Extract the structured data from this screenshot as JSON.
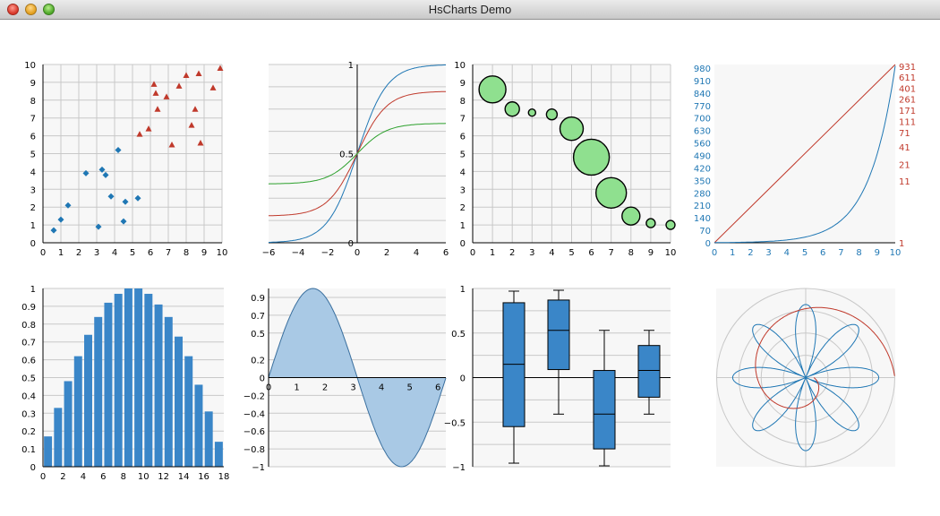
{
  "window": {
    "title": "HsCharts Demo"
  },
  "chart_data": [
    {
      "type": "scatter",
      "xlim": [
        0,
        10
      ],
      "ylim": [
        0,
        10
      ],
      "xticks": [
        "0",
        "1",
        "2",
        "3",
        "4",
        "5",
        "6",
        "7",
        "8",
        "9",
        "10"
      ],
      "yticks": [
        "0",
        "1",
        "2",
        "3",
        "4",
        "5",
        "6",
        "7",
        "8",
        "9",
        "10"
      ],
      "grid": true,
      "series": [
        {
          "marker": "diamond",
          "color": "#1f77b4",
          "points": [
            [
              0.6,
              0.7
            ],
            [
              1.0,
              1.3
            ],
            [
              1.4,
              2.1
            ],
            [
              2.4,
              3.9
            ],
            [
              3.1,
              0.9
            ],
            [
              3.3,
              4.1
            ],
            [
              3.5,
              3.8
            ],
            [
              3.8,
              2.6
            ],
            [
              4.2,
              5.2
            ],
            [
              4.5,
              1.2
            ],
            [
              4.6,
              2.3
            ],
            [
              5.3,
              2.5
            ]
          ]
        },
        {
          "marker": "triangle",
          "color": "#c0392b",
          "points": [
            [
              5.4,
              6.1
            ],
            [
              5.9,
              6.4
            ],
            [
              6.2,
              8.9
            ],
            [
              6.3,
              8.4
            ],
            [
              6.4,
              7.5
            ],
            [
              6.9,
              8.2
            ],
            [
              7.2,
              5.5
            ],
            [
              7.6,
              8.8
            ],
            [
              8.0,
              9.4
            ],
            [
              8.3,
              6.6
            ],
            [
              8.5,
              7.5
            ],
            [
              8.7,
              9.5
            ],
            [
              8.8,
              5.6
            ],
            [
              9.5,
              8.7
            ],
            [
              9.9,
              9.8
            ]
          ]
        }
      ]
    },
    {
      "type": "line",
      "xlim": [
        -6,
        6
      ],
      "ylim": [
        0,
        1
      ],
      "xticks": [
        "-6",
        "-4",
        "-2",
        "0",
        "2",
        "4",
        "6"
      ],
      "yticks": [
        "0",
        "0.5",
        "1"
      ],
      "grid": true,
      "series": [
        {
          "color": "#1f77b4",
          "function": "1/(1+exp(-x))"
        },
        {
          "color": "#c0392b",
          "function": "0.5+0.35*tanh(x/2)"
        },
        {
          "color": "#2ca02c",
          "function": "0.5+0.17*tanh(x/2)"
        }
      ]
    },
    {
      "type": "scatter",
      "marker": "bubble",
      "xlim": [
        0,
        10
      ],
      "ylim": [
        0,
        10
      ],
      "xticks": [
        "0",
        "1",
        "2",
        "3",
        "4",
        "5",
        "6",
        "7",
        "8",
        "9",
        "10"
      ],
      "yticks": [
        "0",
        "1",
        "2",
        "3",
        "4",
        "5",
        "6",
        "7",
        "8",
        "9",
        "10"
      ],
      "grid": true,
      "color": "#8fe08f",
      "points": [
        {
          "x": 1,
          "y": 8.6,
          "size": 15
        },
        {
          "x": 2,
          "y": 7.5,
          "size": 8
        },
        {
          "x": 3,
          "y": 7.3,
          "size": 4
        },
        {
          "x": 4,
          "y": 7.2,
          "size": 6
        },
        {
          "x": 5,
          "y": 6.4,
          "size": 13
        },
        {
          "x": 6,
          "y": 4.8,
          "size": 20
        },
        {
          "x": 7,
          "y": 2.8,
          "size": 17
        },
        {
          "x": 8,
          "y": 1.5,
          "size": 10
        },
        {
          "x": 9,
          "y": 1.1,
          "size": 5
        },
        {
          "x": 10,
          "y": 1.0,
          "size": 5
        }
      ]
    },
    {
      "type": "line",
      "xlim": [
        0,
        10
      ],
      "xticks": [
        "0",
        "1",
        "2",
        "3",
        "4",
        "5",
        "6",
        "7",
        "8",
        "9",
        "10"
      ],
      "left_axis": {
        "color": "#1f77b4",
        "ylim": [
          0,
          1000
        ],
        "ticks": [
          "0",
          "70",
          "140",
          "210",
          "280",
          "350",
          "420",
          "490",
          "560",
          "630",
          "700",
          "770",
          "840",
          "910",
          "980"
        ]
      },
      "right_axis": {
        "color": "#c0392b",
        "scale": "log",
        "ylim": [
          1,
          1000
        ],
        "ticks": [
          "1",
          "11",
          "21",
          "41",
          "71",
          "111",
          "171",
          "261",
          "401",
          "611",
          "931"
        ]
      },
      "series": [
        {
          "axis": "left",
          "color": "#1f77b4",
          "function": "exp(0.69*x)"
        },
        {
          "axis": "right",
          "color": "#c0392b",
          "function": "10^(0.3*x)"
        }
      ]
    },
    {
      "type": "bar",
      "xlim": [
        0,
        18
      ],
      "ylim": [
        0,
        1
      ],
      "xticks": [
        "0",
        "2",
        "4",
        "6",
        "8",
        "10",
        "12",
        "14",
        "16",
        "18"
      ],
      "yticks": [
        "0",
        "0.1",
        "0.2",
        "0.3",
        "0.4",
        "0.5",
        "0.6",
        "0.7",
        "0.8",
        "0.9",
        "1"
      ],
      "grid": true,
      "color": "#3a86c8",
      "x": [
        0.5,
        1.5,
        2.5,
        3.5,
        4.5,
        5.5,
        6.5,
        7.5,
        8.5,
        9.5,
        10.5,
        11.5,
        12.5,
        13.5,
        14.5,
        15.5,
        16.5,
        17.5
      ],
      "values": [
        0.17,
        0.33,
        0.48,
        0.62,
        0.74,
        0.84,
        0.92,
        0.97,
        1.0,
        1.0,
        0.97,
        0.91,
        0.84,
        0.73,
        0.62,
        0.46,
        0.31,
        0.14
      ]
    },
    {
      "type": "area",
      "xlim": [
        0,
        6.28
      ],
      "ylim": [
        -1,
        1
      ],
      "xticks": [
        "0",
        "1",
        "2",
        "3",
        "4",
        "5",
        "6"
      ],
      "yticks": [
        "-1",
        "-0.8",
        "-0.6",
        "-0.4",
        "-0.2",
        "0",
        "0.2",
        "0.5",
        "0.7",
        "0.9"
      ],
      "grid": true,
      "fill": "#a9c9e5",
      "stroke": "#3a6f9e",
      "function": "sin(x)"
    },
    {
      "type": "box",
      "ylim": [
        -1,
        1
      ],
      "yticks": [
        "-1",
        "-0.5",
        "0",
        "0.5",
        "1"
      ],
      "grid": true,
      "color": "#3a86c8",
      "boxes": [
        {
          "min": -0.96,
          "q1": -0.55,
          "median": 0.15,
          "q3": 0.84,
          "max": 0.97
        },
        {
          "min": -0.41,
          "q1": 0.09,
          "median": 0.53,
          "q3": 0.87,
          "max": 0.98
        },
        {
          "min": -0.99,
          "q1": -0.8,
          "median": -0.41,
          "q3": 0.08,
          "max": 0.53
        },
        {
          "min": -0.41,
          "q1": -0.22,
          "median": 0.08,
          "q3": 0.36,
          "max": 0.53
        }
      ]
    },
    {
      "type": "polar",
      "rlim": [
        0,
        1
      ],
      "grid": true,
      "series": [
        {
          "color": "#1f77b4",
          "function": "r=|cos(4*theta)|*0.82"
        },
        {
          "color": "#c0392b",
          "function": "spiral r=0.09+0.145*theta"
        }
      ]
    }
  ]
}
